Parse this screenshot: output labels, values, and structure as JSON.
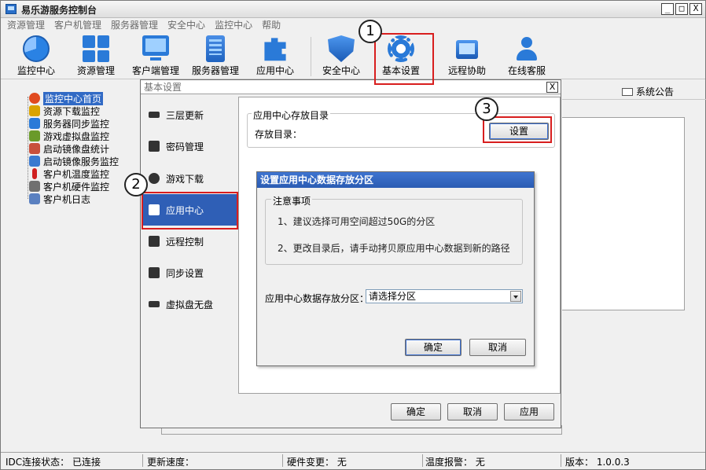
{
  "window": {
    "title": "易乐游服务控制台",
    "min": "_",
    "max": "□",
    "close": "X"
  },
  "menu": [
    "资源管理",
    "客户机管理",
    "服务器管理",
    "安全中心",
    "监控中心",
    "帮助"
  ],
  "toolbar": [
    {
      "label": "监控中心",
      "icon": "pie-chart-icon"
    },
    {
      "label": "资源管理",
      "icon": "grid-icon"
    },
    {
      "label": "客户端管理",
      "icon": "monitor-icon"
    },
    {
      "label": "服务器管理",
      "icon": "server-icon"
    },
    {
      "label": "应用中心",
      "icon": "puzzle-icon"
    },
    {
      "label": "安全中心",
      "icon": "shield-icon"
    },
    {
      "label": "基本设置",
      "icon": "gear-icon"
    },
    {
      "label": "远程协助",
      "icon": "remote-desktop-icon"
    },
    {
      "label": "在线客服",
      "icon": "user-icon"
    }
  ],
  "tree": [
    {
      "label": "监控中心首页",
      "color": "#e04a1f"
    },
    {
      "label": "资源下载监控",
      "color": "#d9a300"
    },
    {
      "label": "服务器同步监控",
      "color": "#2a7ad8"
    },
    {
      "label": "游戏虚拟盘监控",
      "color": "#6a9a2a"
    },
    {
      "label": "启动镜像盘统计",
      "color": "#c8503c"
    },
    {
      "label": "启动镜像服务监控",
      "color": "#3a7ad0"
    },
    {
      "label": "客户机温度监控",
      "color": "#d02020"
    },
    {
      "label": "客户机硬件监控",
      "color": "#707070"
    },
    {
      "label": "客户机日志",
      "color": "#5a80c0"
    }
  ],
  "notice": "系统公告",
  "dialog": {
    "title": "基本设置",
    "close": "X",
    "nav": [
      "三层更新",
      "密码管理",
      "游戏下载",
      "应用中心",
      "远程控制",
      "同步设置",
      "虚拟盘无盘"
    ],
    "group_title": "应用中心存放目录",
    "dir_label": "存放目录：",
    "set_button": "设置",
    "ok": "确定",
    "cancel": "取消",
    "apply": "应用"
  },
  "subdialog": {
    "title": "设置应用中心数据存放分区",
    "notes_title": "注意事项",
    "note1": "1、建议选择可用空间超过50G的分区",
    "note2": "2、更改目录后，请手动拷贝原应用中心数据到新的路径",
    "partition_label": "应用中心数据存放分区：",
    "partition_value": "请选择分区",
    "ok": "确定",
    "cancel": "取消"
  },
  "markers": [
    "1",
    "2",
    "3"
  ],
  "status": {
    "idc": "IDC连接状态： 已连接",
    "speed": "更新速度：",
    "hw": "硬件变更： 无",
    "temp": "温度报警： 无",
    "version": "版本： 1.0.0.3"
  }
}
